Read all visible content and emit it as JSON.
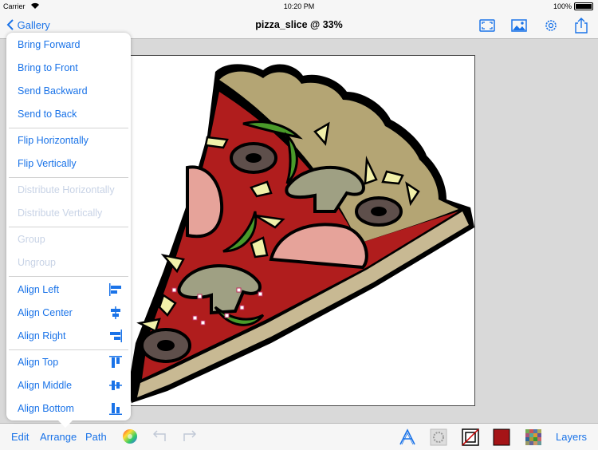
{
  "status_bar": {
    "carrier": "Carrier",
    "time": "10:20 PM",
    "battery": "100%"
  },
  "nav": {
    "back_label": "Gallery",
    "title": "pizza_slice @ 33%",
    "icons": [
      "fullscreen-icon",
      "image-icon",
      "settings-gear-icon",
      "share-icon"
    ]
  },
  "menu": {
    "items": [
      {
        "label": "Bring Forward",
        "enabled": true
      },
      {
        "label": "Bring to Front",
        "enabled": true
      },
      {
        "label": "Send Backward",
        "enabled": true
      },
      {
        "label": "Send to Back",
        "enabled": true
      },
      {
        "label": "Flip Horizontally",
        "enabled": true
      },
      {
        "label": "Flip Vertically",
        "enabled": true
      },
      {
        "label": "Distribute Horizontally",
        "enabled": false
      },
      {
        "label": "Distribute Vertically",
        "enabled": false
      },
      {
        "label": "Group",
        "enabled": false
      },
      {
        "label": "Ungroup",
        "enabled": false
      },
      {
        "label": "Align Left",
        "enabled": true,
        "icon": "align-left-icon"
      },
      {
        "label": "Align Center",
        "enabled": true,
        "icon": "align-center-icon"
      },
      {
        "label": "Align Right",
        "enabled": true,
        "icon": "align-right-icon"
      },
      {
        "label": "Align Top",
        "enabled": true,
        "icon": "align-top-icon"
      },
      {
        "label": "Align Middle",
        "enabled": true,
        "icon": "align-middle-icon"
      },
      {
        "label": "Align Bottom",
        "enabled": true,
        "icon": "align-bottom-icon"
      }
    ]
  },
  "toolbar": {
    "edit": "Edit",
    "arrange": "Arrange",
    "path": "Path",
    "layers": "Layers",
    "fill_color": "#a51417",
    "icons": [
      "color-wheel-icon",
      "undo-icon",
      "redo-icon",
      "text-tool-icon",
      "shadow-icon",
      "stroke-icon",
      "fill-swatch-icon",
      "pattern-icon"
    ]
  },
  "colors": {
    "accent": "#1a73e8",
    "disabled": "#c8d3e6"
  }
}
